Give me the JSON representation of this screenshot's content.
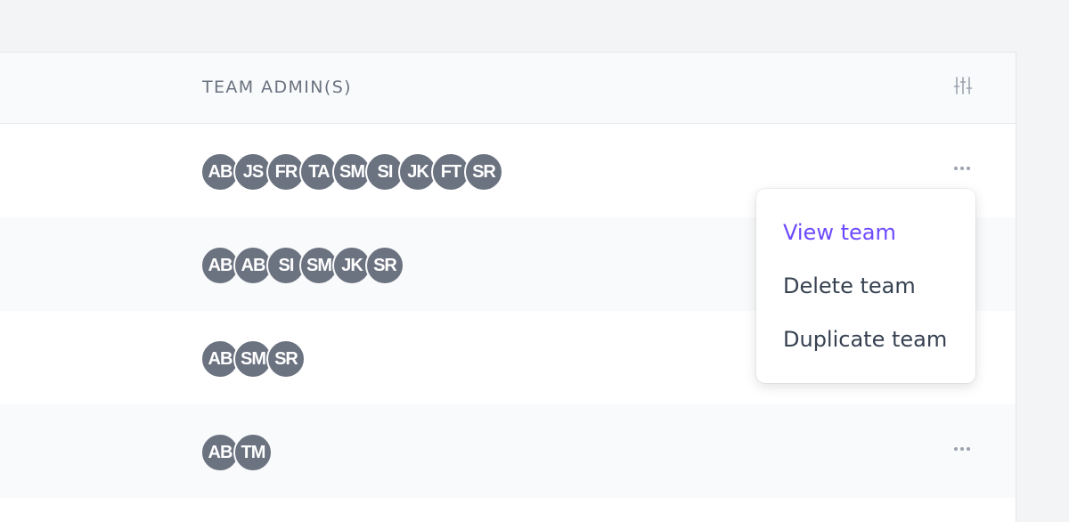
{
  "table": {
    "column_header": "TEAM ADMIN(S)",
    "filter_icon": "sliders-icon",
    "rows": [
      {
        "admins": [
          "AB",
          "JS",
          "FR",
          "TA",
          "SM",
          "SI",
          "JK",
          "FT",
          "SR"
        ],
        "has_menu": true
      },
      {
        "admins": [
          "AB",
          "AB",
          "SI",
          "SM",
          "JK",
          "SR"
        ],
        "has_menu": false
      },
      {
        "admins": [
          "AB",
          "SM",
          "SR"
        ],
        "has_menu": false
      },
      {
        "admins": [
          "AB",
          "TM"
        ],
        "has_menu": true
      }
    ]
  },
  "dropdown": {
    "items": [
      {
        "label": "View team",
        "active": true
      },
      {
        "label": "Delete team",
        "active": false
      },
      {
        "label": "Duplicate team",
        "active": false
      }
    ]
  },
  "colors": {
    "avatar_bg": "#6b7280",
    "accent": "#6d4aff",
    "page_bg": "#f3f4f6"
  }
}
